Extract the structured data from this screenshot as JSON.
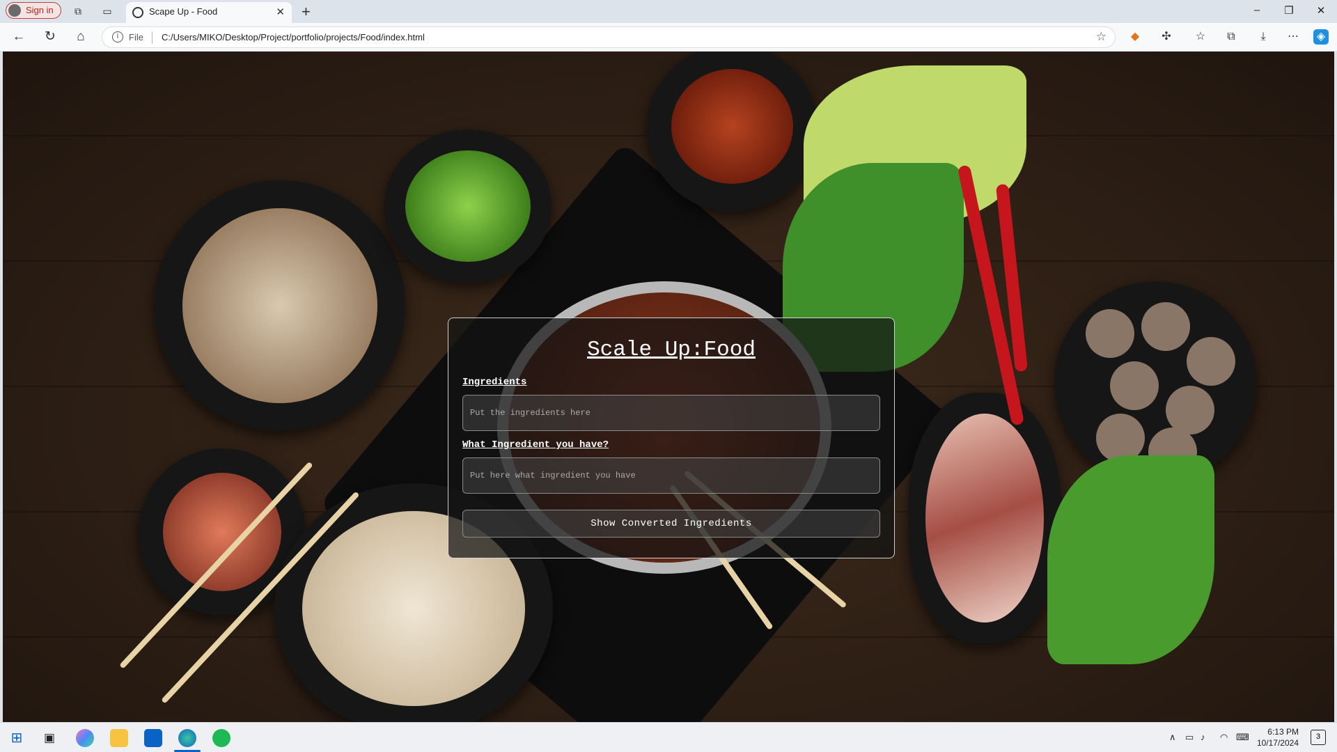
{
  "browser": {
    "signin_label": "Sign in",
    "tab_title": "Scape Up - Food",
    "address_protocol": "File",
    "address_url": "C:/Users/MIKO/Desktop/Project/portfolio/projects/Food/index.html"
  },
  "page": {
    "title": "Scale Up:Food",
    "ingredients_label": "Ingredients",
    "ingredients_placeholder": "Put the ingredients here",
    "have_label": "What Ingredient you have?",
    "have_placeholder": "Put here what ingredient you have",
    "button_label": "Show Converted Ingredients"
  },
  "taskbar": {
    "time": "6:13 PM",
    "date": "10/17/2024",
    "notification_count": "3"
  }
}
